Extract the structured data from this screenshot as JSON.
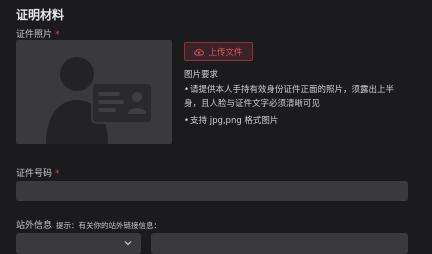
{
  "section": {
    "title": "证明材料"
  },
  "id_photo": {
    "label": "证件照片",
    "required_mark": "*",
    "upload_label": "上传文件",
    "requirements_title": "图片要求",
    "requirements": [
      "请提供本人手持有效身份证件正面的照片，须露出上半身，且人脸与证件文字必须清晰可见",
      "支持 jpg,png 格式图片"
    ]
  },
  "id_number": {
    "label": "证件号码",
    "required_mark": "*",
    "value": ""
  },
  "external_info": {
    "label": "站外信息",
    "hint": "提示：有关你的站外链接信息：",
    "select_value": "",
    "link_value": ""
  },
  "colors": {
    "background": "#1b1b1d",
    "field": "#3a3a3c",
    "accent": "#e0424f"
  }
}
